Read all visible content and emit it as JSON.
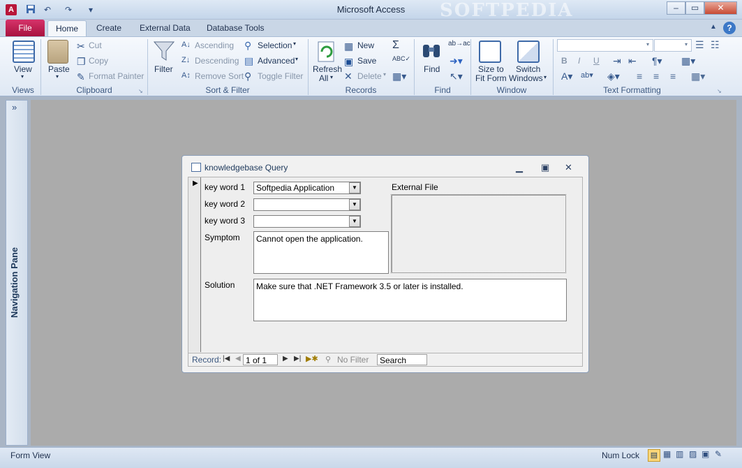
{
  "window": {
    "title": "Microsoft Access",
    "watermark": "SOFTPEDIA"
  },
  "quick_access": [
    {
      "icon": "save-icon"
    },
    {
      "icon": "undo-icon"
    },
    {
      "icon": "redo-icon"
    },
    {
      "icon": "customize-qat-icon"
    }
  ],
  "window_buttons": {
    "minimize": "–",
    "restore": "▭",
    "close": "✕"
  },
  "ribbon_tabs": {
    "file": "File",
    "home": "Home",
    "create": "Create",
    "external_data": "External Data",
    "database_tools": "Database Tools"
  },
  "groups": {
    "views": {
      "label": "Views",
      "view": "View"
    },
    "clipboard": {
      "label": "Clipboard",
      "paste": "Paste",
      "cut": "Cut",
      "copy": "Copy",
      "format_painter": "Format Painter"
    },
    "sort_filter": {
      "label": "Sort & Filter",
      "filter": "Filter",
      "ascending": "Ascending",
      "descending": "Descending",
      "remove_sort": "Remove Sort",
      "selection": "Selection",
      "advanced": "Advanced",
      "toggle_filter": "Toggle Filter"
    },
    "records": {
      "label": "Records",
      "refresh": "Refresh",
      "refresh2": "All",
      "new": "New",
      "save": "Save",
      "delete": "Delete"
    },
    "find": {
      "label": "Find",
      "find": "Find"
    },
    "window": {
      "label": "Window",
      "size_to": "Size to",
      "fit_form": "Fit Form",
      "switch": "Switch",
      "windows": "Windows"
    },
    "text_formatting": {
      "label": "Text Formatting",
      "bold": "B",
      "italic": "I",
      "underline": "U"
    }
  },
  "nav_pane": {
    "label": "Navigation Pane",
    "toggle": "»"
  },
  "form": {
    "title": "knowledgebase Query",
    "fields": {
      "kw1_label": "key word 1",
      "kw1_value": "Softpedia Application",
      "kw2_label": "key word 2",
      "kw2_value": "",
      "kw3_label": "key word 3",
      "kw3_value": "",
      "symptom_label": "Symptom",
      "symptom_value": "Cannot open the application.",
      "solution_label": "Solution",
      "solution_value": "Make sure that .NET Framework 3.5 or later is installed.",
      "external_file_label": "External File"
    },
    "record_nav": {
      "label": "Record:",
      "position": "1 of 1",
      "filter": "No Filter",
      "search": "Search"
    }
  },
  "status": {
    "view": "Form View",
    "numlock": "Num Lock"
  }
}
